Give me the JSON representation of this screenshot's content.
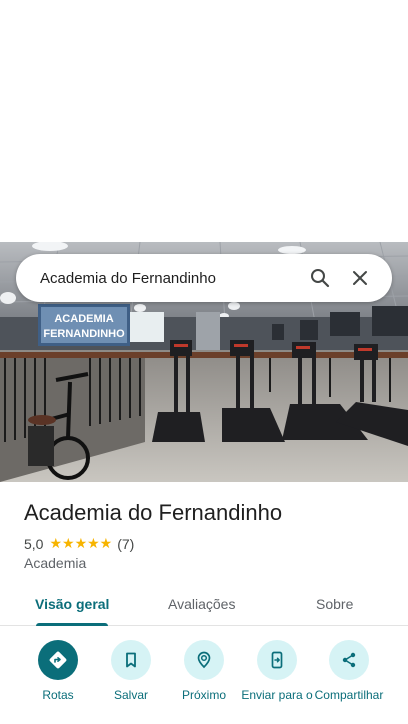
{
  "search": {
    "query": "Academia do Fernandinho"
  },
  "photo": {
    "banner_text": "ACADEMIA FERNANDINHO"
  },
  "place": {
    "name": "Academia do Fernandinho",
    "rating": "5,0",
    "stars": "★★★★★",
    "review_count": "(7)",
    "category": "Academia"
  },
  "tabs": [
    {
      "label": "Visão geral",
      "active": true
    },
    {
      "label": "Avaliações",
      "active": false
    },
    {
      "label": "Sobre",
      "active": false
    }
  ],
  "actions": [
    {
      "label": "Rotas",
      "icon": "directions-icon"
    },
    {
      "label": "Salvar",
      "icon": "bookmark-icon"
    },
    {
      "label": "Próximo",
      "icon": "nearby-icon"
    },
    {
      "label": "Enviar para o",
      "icon": "send-to-phone-icon"
    },
    {
      "label": "Compartilhar",
      "icon": "share-icon"
    }
  ],
  "colors": {
    "accent": "#0b6e7a",
    "action_bg": "#d6f3f5",
    "star": "#f7b400"
  }
}
